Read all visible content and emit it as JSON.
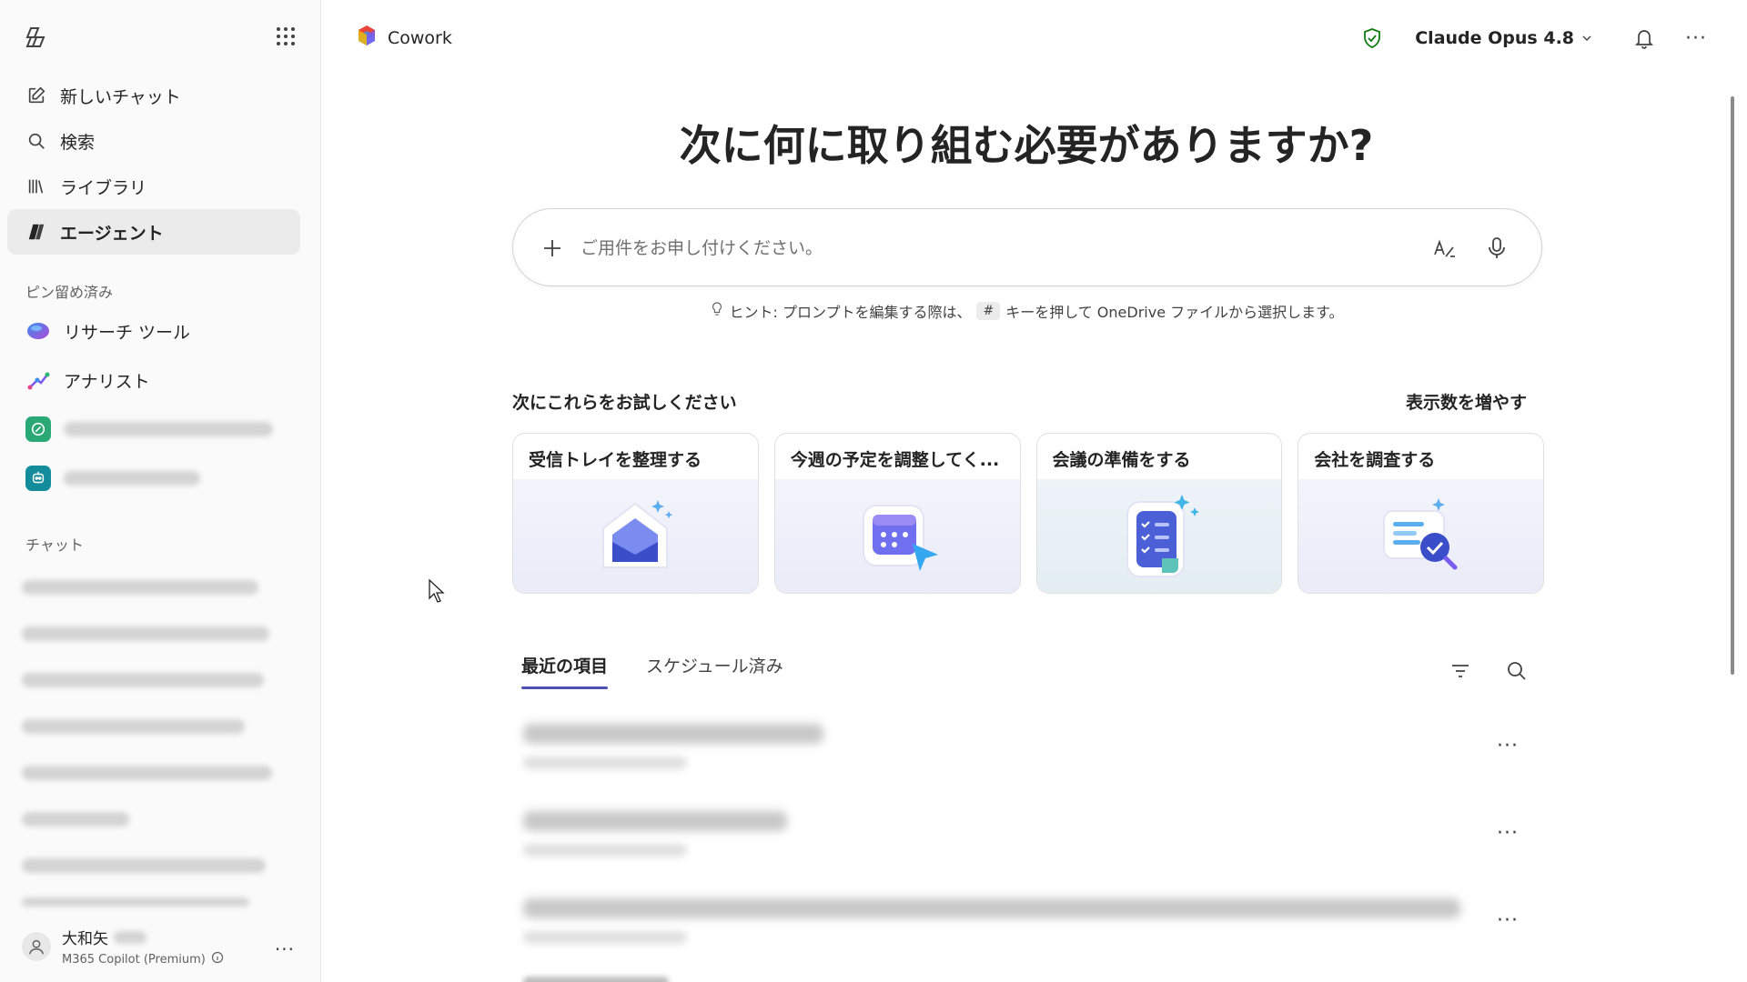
{
  "sidebar": {
    "nav": [
      {
        "label": "新しいチャット",
        "icon": "compose-icon"
      },
      {
        "label": "検索",
        "icon": "search-icon"
      },
      {
        "label": "ライブラリ",
        "icon": "library-icon"
      },
      {
        "label": "エージェント",
        "icon": "agents-icon",
        "active": true
      }
    ],
    "pinned_label": "ピン留め済み",
    "pinned": [
      {
        "label": "リサーチ ツール",
        "icon": "researcher-icon"
      },
      {
        "label": "アナリスト",
        "icon": "analyst-icon"
      }
    ],
    "chats_label": "チャット",
    "user": {
      "name": "大和矢",
      "plan": "M365 Copilot (Premium)"
    }
  },
  "topbar": {
    "app_name": "Cowork",
    "model": "Claude Opus 4.8"
  },
  "main": {
    "heading": "次に何に取り組む必要がありますか?",
    "prompt_placeholder": "ご用件をお申し付けください。",
    "hint_prefix": "ヒント: プロンプトを編集する際は、",
    "hint_key": "#",
    "hint_suffix": "キーを押して OneDrive ファイルから選択します。",
    "try_title": "次にこれらをお試しください",
    "try_more": "表示数を増やす",
    "cards": [
      {
        "title": "受信トレイを整理する",
        "icon": "inbox-icon"
      },
      {
        "title": "今週の予定を調整してく...",
        "icon": "calendar-icon"
      },
      {
        "title": "会議の準備をする",
        "icon": "checklist-icon"
      },
      {
        "title": "会社を調査する",
        "icon": "research-icon"
      }
    ],
    "tabs": [
      {
        "label": "最近の項目",
        "active": true
      },
      {
        "label": "スケジュール済み",
        "active": false
      }
    ]
  },
  "colors": {
    "accent": "#4f52b2",
    "sidebar_bg": "#fafafa",
    "active_item_bg": "#ebebeb",
    "shield_green": "#107c10"
  }
}
